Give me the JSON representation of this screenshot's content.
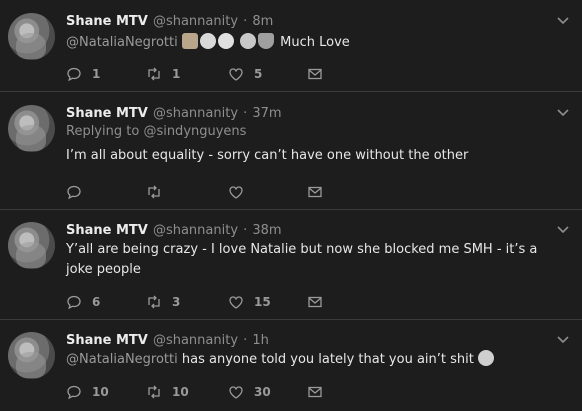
{
  "tweets": [
    {
      "name": "Shane MTV",
      "handle": "@shannanity",
      "separator": "·",
      "time": "8m",
      "reply_to_prefix": "",
      "reply_to_user": "",
      "mention": "@NataliaNegrotti",
      "text": "Much Love",
      "emojis": [
        "detective-emoji",
        "no-mouth-emoji",
        "grinning-emoji",
        "smiling-horns-emoji",
        "pray-emoji"
      ],
      "reply_count": "1",
      "retweet_count": "1",
      "like_count": "5"
    },
    {
      "name": "Shane MTV",
      "handle": "@shannanity",
      "separator": "·",
      "time": "37m",
      "reply_to_prefix": "Replying to",
      "reply_to_user": "@sindynguyens",
      "mention": "",
      "text": "I’m all about equality - sorry can’t have one without the other",
      "emojis": [],
      "reply_count": "",
      "retweet_count": "",
      "like_count": ""
    },
    {
      "name": "Shane MTV",
      "handle": "@shannanity",
      "separator": "·",
      "time": "38m",
      "reply_to_prefix": "",
      "reply_to_user": "",
      "mention": "",
      "text": "Y’all are being crazy - I love Natalie but now she blocked me SMH - it’s a joke people",
      "emojis": [],
      "reply_count": "6",
      "retweet_count": "3",
      "like_count": "15"
    },
    {
      "name": "Shane MTV",
      "handle": "@shannanity",
      "separator": "·",
      "time": "1h",
      "reply_to_prefix": "",
      "reply_to_user": "",
      "mention": "@NataliaNegrotti",
      "text": "has anyone told you lately that you ain’t shit",
      "emojis": [
        "wink-kiss-emoji"
      ],
      "reply_count": "10",
      "retweet_count": "10",
      "like_count": "30"
    }
  ],
  "icons": {
    "reply": "reply-icon",
    "retweet": "retweet-icon",
    "like": "heart-icon",
    "message": "envelope-icon",
    "more": "chevron-down-icon"
  },
  "colors": {
    "background": "#1d1d1d",
    "divider": "#3a3a3a",
    "text": "#e7e7e7",
    "muted": "#8e8e8e"
  }
}
